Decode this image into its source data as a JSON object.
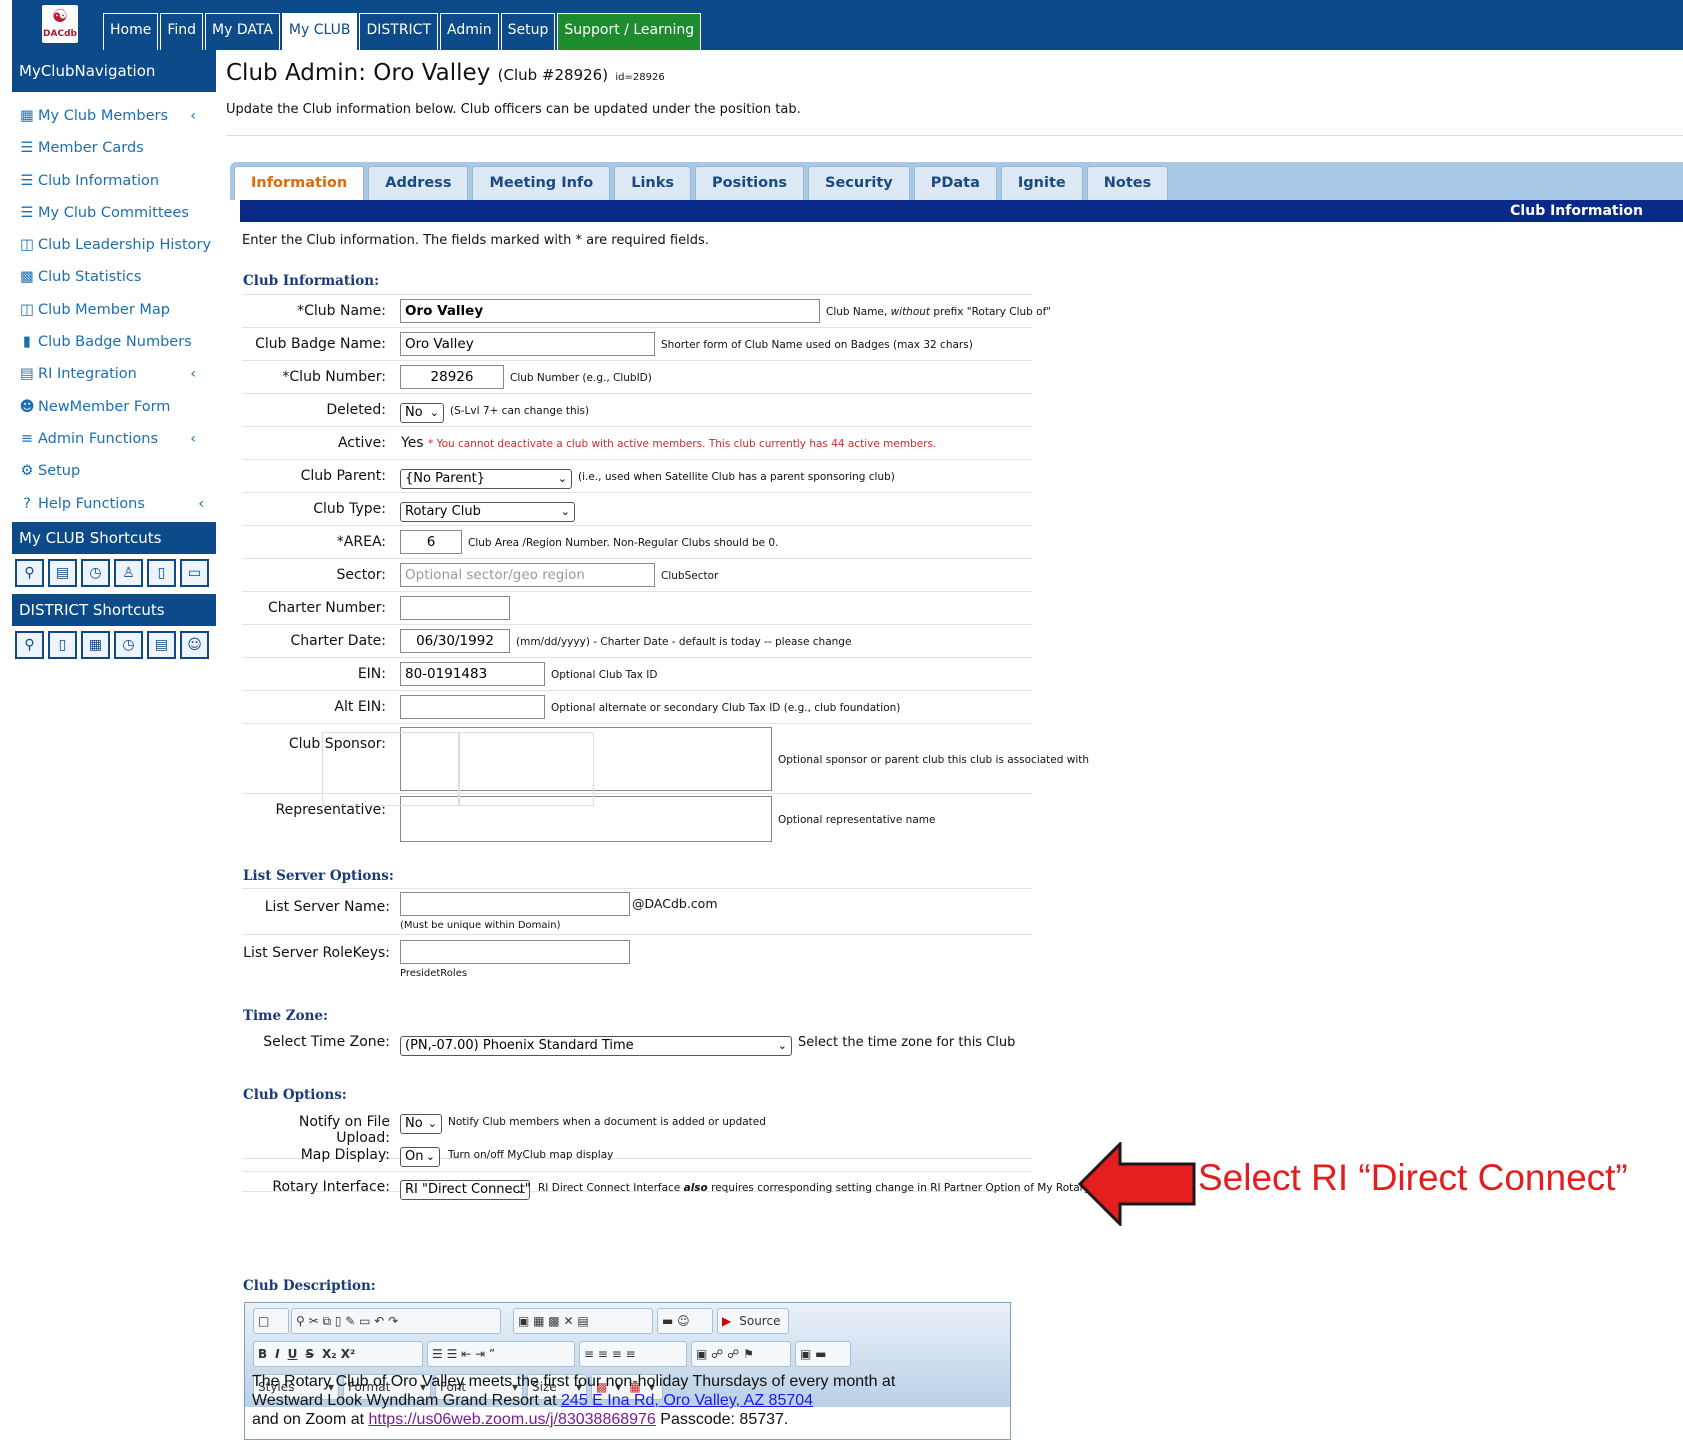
{
  "topnav": {
    "logo_text": "DACdb",
    "tabs": [
      "Home",
      "Find",
      "My DATA",
      "My CLUB",
      "DISTRICT",
      "Admin",
      "Setup",
      "Support / Learning"
    ]
  },
  "sidebar": {
    "title": "MyClubNavigation",
    "items": [
      {
        "label": "My Club Members",
        "icon": "members-icon",
        "chevron": "‹"
      },
      {
        "label": "Member Cards",
        "icon": "list-icon"
      },
      {
        "label": "Club Information",
        "icon": "list-icon"
      },
      {
        "label": "My Club Committees",
        "icon": "list-icon"
      },
      {
        "label": "Club Leadership History",
        "icon": "history-icon"
      },
      {
        "label": "Club Statistics",
        "icon": "stats-icon"
      },
      {
        "label": "Club Member Map",
        "icon": "map-icon"
      },
      {
        "label": "Club Badge Numbers",
        "icon": "badge-icon"
      },
      {
        "label": "RI Integration",
        "icon": "integration-icon",
        "chevron": "‹"
      },
      {
        "label": "NewMember Form",
        "icon": "add-user-icon"
      },
      {
        "label": "Admin Functions",
        "icon": "menu-icon",
        "chevron": "‹"
      },
      {
        "label": "Setup",
        "icon": "gear-icon"
      },
      {
        "label": "Help Functions",
        "icon": "question-icon",
        "chevron": "‹"
      }
    ],
    "club_shortcuts_title": "My CLUB Shortcuts",
    "district_shortcuts_title": "DISTRICT Shortcuts"
  },
  "page": {
    "title": "Club Admin: Oro Valley",
    "club_num": "(Club #28926)",
    "id_text": "id=28926",
    "subtitle": "Update the Club information below. Club officers can be updated under the position tab.",
    "tabs": [
      "Information",
      "Address",
      "Meeting Info",
      "Links",
      "Positions",
      "Security",
      "PData",
      "Ignite",
      "Notes"
    ],
    "band_title": "Club Information",
    "intro": "Enter the Club information. The fields marked with * are required fields."
  },
  "club_info": {
    "section": "Club Information:",
    "club_name": {
      "label": "*Club Name:",
      "value": "Oro Valley",
      "note_pre": "Club Name, ",
      "note_em": "without",
      "note_post": " prefix \"Rotary Club of\""
    },
    "badge_name": {
      "label": "Club Badge Name:",
      "value": "Oro Valley",
      "note": "Shorter form of Club Name used on Badges (max 32 chars)"
    },
    "club_number": {
      "label": "*Club Number:",
      "value": "28926",
      "note": "Club Number (e.g., ClubID)"
    },
    "deleted": {
      "label": "Deleted:",
      "value": "No",
      "note": "(S-Lvl 7+ can change this)"
    },
    "active": {
      "label": "Active:",
      "value": "Yes",
      "note": "* You cannot deactivate a club with active members. This club currently has 44 active members."
    },
    "parent": {
      "label": "Club Parent:",
      "value": "{No Parent}",
      "note": "(i.e., used when Satellite Club has a parent sponsoring club)"
    },
    "type": {
      "label": "Club Type:",
      "value": "Rotary Club"
    },
    "area": {
      "label": "*AREA:",
      "value": "6",
      "note": "Club Area /Region Number. Non-Regular Clubs should be 0."
    },
    "sector": {
      "label": "Sector:",
      "placeholder": "Optional sector/geo region",
      "note": "ClubSector"
    },
    "charter_number": {
      "label": "Charter Number:",
      "value": ""
    },
    "charter_date": {
      "label": "Charter Date:",
      "value": "06/30/1992",
      "note": "(mm/dd/yyyy) - Charter Date - default is today -- please change"
    },
    "ein": {
      "label": "EIN:",
      "value": "80-0191483",
      "note": "Optional Club Tax ID"
    },
    "alt_ein": {
      "label": "Alt EIN:",
      "value": "",
      "note": "Optional alternate or secondary Club Tax ID (e.g., club foundation)"
    },
    "sponsor": {
      "label": "Club Sponsor:",
      "note": "Optional sponsor or parent club this club is associated with"
    },
    "representative": {
      "label": "Representative:",
      "note": "Optional representative name"
    }
  },
  "list_server": {
    "section": "List Server Options:",
    "name_label": "List Server Name:",
    "domain": "@DACdb.com",
    "name_note": "(Must be unique within Domain)",
    "rolekeys_label": "List Server RoleKeys:",
    "rolekeys_note": "PresidetRoles"
  },
  "time_zone": {
    "section": "Time Zone:",
    "label": "Select Time Zone:",
    "value": "(PN,-07.00) Phoenix Standard Time",
    "note": "Select the time zone for this Club"
  },
  "club_options": {
    "section": "Club Options:",
    "notify": {
      "label": "Notify on File Upload:",
      "value": "No",
      "note": "Notify Club members when a document is added or updated"
    },
    "map": {
      "label": "Map Display:",
      "value": "On",
      "note": "Turn on/off MyClub map display"
    },
    "rotary": {
      "label": "Rotary Interface:",
      "value": "RI \"Direct Connect\"",
      "note_pre": "RI Direct Connect Interface ",
      "note_em": "also",
      "note_post": " requires corresponding setting change in RI Partner Option of My Rotary."
    }
  },
  "description": {
    "section": "Club Description:",
    "source_label": "Source",
    "dropdowns": [
      "Styles",
      "Format",
      "Font",
      "Size"
    ],
    "line1": "The Rotary Club of Oro Valley meets the first four non-holiday Thursdays of every month at",
    "line2_pre": "Westward Look Wyndham Grand Resort at ",
    "line2_link": "245 E Ina Rd, Oro Valley, AZ 85704",
    "line3_pre": "and on Zoom at ",
    "line3_link": "https://us06web.zoom.us/j/83038868976",
    "line3_post": " Passcode: 85737."
  },
  "annotation": {
    "text": "Select RI “Direct Connect”",
    "color": "#e41e1e"
  }
}
